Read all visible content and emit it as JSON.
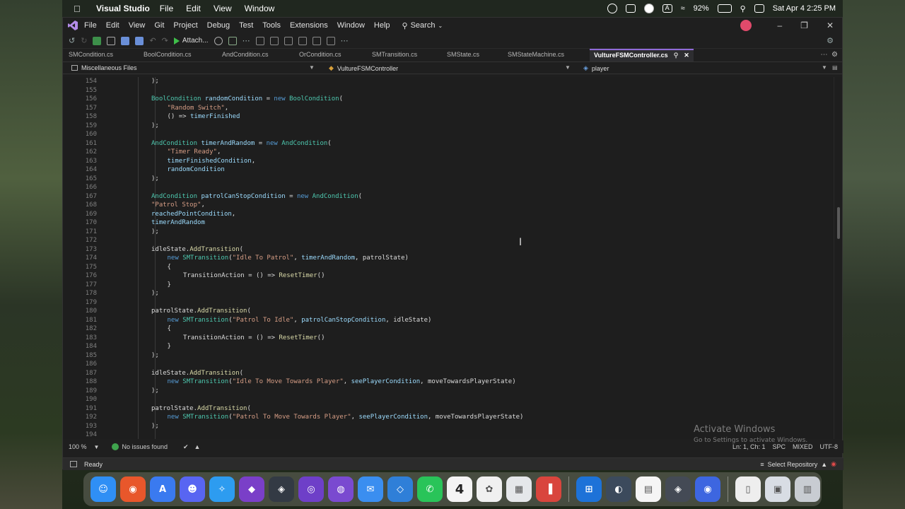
{
  "mac_menubar": {
    "app_name": "Visual Studio",
    "menus": [
      "File",
      "Edit",
      "View",
      "Window"
    ],
    "battery": "92%",
    "datetime": "Sat Apr 4  2:25 PM",
    "status_icons": [
      "shield-icon",
      "screen-mirror-icon",
      "record-icon",
      "input-source-icon",
      "wifi-icon",
      "battery-icon",
      "spotlight-icon",
      "control-center-icon"
    ]
  },
  "vs_menu": {
    "items": [
      "File",
      "Edit",
      "View",
      "Git",
      "Project",
      "Debug",
      "Test",
      "Tools",
      "Extensions",
      "Window",
      "Help"
    ],
    "search_label": "Search"
  },
  "toolbar": {
    "attach_label": "Attach..."
  },
  "tabs": [
    {
      "label": "SMCondition.cs",
      "active": false
    },
    {
      "label": "BoolCondition.cs",
      "active": false
    },
    {
      "label": "AndCondition.cs",
      "active": false
    },
    {
      "label": "OrCondition.cs",
      "active": false
    },
    {
      "label": "SMTransition.cs",
      "active": false
    },
    {
      "label": "SMState.cs",
      "active": false
    },
    {
      "label": "SMStateMachine.cs",
      "active": false
    },
    {
      "label": "VultureFSMController.cs",
      "active": true
    }
  ],
  "navbar": {
    "project": "Miscellaneous Files",
    "class": "VultureFSMController",
    "member": "player"
  },
  "code_lines": [
    {
      "n": "154",
      "indent": 0,
      "tokens": [
        [
          "pl",
          ");"
        ]
      ]
    },
    {
      "n": "155",
      "indent": 0,
      "tokens": []
    },
    {
      "n": "156",
      "indent": 0,
      "tokens": [
        [
          "ty",
          "BoolCondition"
        ],
        [
          "pl",
          " "
        ],
        [
          "id",
          "randomCondition"
        ],
        [
          "pl",
          " = "
        ],
        [
          "kw",
          "new"
        ],
        [
          "pl",
          " "
        ],
        [
          "ty",
          "BoolCondition"
        ],
        [
          "pl",
          "("
        ]
      ]
    },
    {
      "n": "157",
      "indent": 1,
      "tokens": [
        [
          "str",
          "\"Random Switch\""
        ],
        [
          "pl",
          ","
        ]
      ]
    },
    {
      "n": "158",
      "indent": 1,
      "tokens": [
        [
          "pl",
          "() => "
        ],
        [
          "id",
          "timerFinished"
        ]
      ]
    },
    {
      "n": "159",
      "indent": 0,
      "tokens": [
        [
          "pl",
          ");"
        ]
      ]
    },
    {
      "n": "160",
      "indent": 0,
      "tokens": []
    },
    {
      "n": "161",
      "indent": 0,
      "tokens": [
        [
          "ty",
          "AndCondition"
        ],
        [
          "pl",
          " "
        ],
        [
          "id",
          "timerAndRandom"
        ],
        [
          "pl",
          " = "
        ],
        [
          "kw",
          "new"
        ],
        [
          "pl",
          " "
        ],
        [
          "ty",
          "AndCondition"
        ],
        [
          "pl",
          "("
        ]
      ]
    },
    {
      "n": "162",
      "indent": 1,
      "tokens": [
        [
          "str",
          "\"Timer Ready\""
        ],
        [
          "pl",
          ","
        ]
      ]
    },
    {
      "n": "163",
      "indent": 1,
      "tokens": [
        [
          "id",
          "timerFinishedCondition"
        ],
        [
          "pl",
          ","
        ]
      ]
    },
    {
      "n": "164",
      "indent": 1,
      "tokens": [
        [
          "id",
          "randomCondition"
        ]
      ]
    },
    {
      "n": "165",
      "indent": 0,
      "tokens": [
        [
          "pl",
          ");"
        ]
      ]
    },
    {
      "n": "166",
      "indent": 0,
      "tokens": []
    },
    {
      "n": "167",
      "indent": 0,
      "tokens": [
        [
          "ty",
          "AndCondition"
        ],
        [
          "pl",
          " "
        ],
        [
          "id",
          "patrolCanStopCondition"
        ],
        [
          "pl",
          " = "
        ],
        [
          "kw",
          "new"
        ],
        [
          "pl",
          " "
        ],
        [
          "ty",
          "AndCondition"
        ],
        [
          "pl",
          "("
        ]
      ]
    },
    {
      "n": "168",
      "indent": 0,
      "tokens": [
        [
          "str",
          "\"Patrol Stop\""
        ],
        [
          "pl",
          ","
        ]
      ]
    },
    {
      "n": "169",
      "indent": 0,
      "tokens": [
        [
          "id",
          "reachedPointCondition"
        ],
        [
          "pl",
          ","
        ]
      ]
    },
    {
      "n": "170",
      "indent": 0,
      "tokens": [
        [
          "id",
          "timerAndRandom"
        ]
      ]
    },
    {
      "n": "171",
      "indent": 0,
      "tokens": [
        [
          "pl",
          ");"
        ]
      ]
    },
    {
      "n": "172",
      "indent": 0,
      "tokens": []
    },
    {
      "n": "173",
      "indent": 0,
      "tokens": [
        [
          "pl",
          "idleState."
        ],
        [
          "mt",
          "AddTransition"
        ],
        [
          "pl",
          "("
        ]
      ]
    },
    {
      "n": "174",
      "indent": 1,
      "tokens": [
        [
          "kw",
          "new"
        ],
        [
          "pl",
          " "
        ],
        [
          "ty",
          "SMTransition"
        ],
        [
          "pl",
          "("
        ],
        [
          "str",
          "\"Idle To Patrol\""
        ],
        [
          "pl",
          ", "
        ],
        [
          "id",
          "timerAndRandom"
        ],
        [
          "pl",
          ", patrolState)"
        ]
      ]
    },
    {
      "n": "175",
      "indent": 1,
      "tokens": [
        [
          "pl",
          "{"
        ]
      ]
    },
    {
      "n": "176",
      "indent": 2,
      "tokens": [
        [
          "pl",
          "TransitionAction = () => "
        ],
        [
          "mt",
          "ResetTimer"
        ],
        [
          "pl",
          "()"
        ]
      ]
    },
    {
      "n": "177",
      "indent": 1,
      "tokens": [
        [
          "pl",
          "}"
        ]
      ]
    },
    {
      "n": "178",
      "indent": 0,
      "tokens": [
        [
          "pl",
          ");"
        ]
      ]
    },
    {
      "n": "179",
      "indent": 0,
      "tokens": []
    },
    {
      "n": "180",
      "indent": 0,
      "tokens": [
        [
          "pl",
          "patrolState."
        ],
        [
          "mt",
          "AddTransition"
        ],
        [
          "pl",
          "("
        ]
      ]
    },
    {
      "n": "181",
      "indent": 1,
      "tokens": [
        [
          "kw",
          "new"
        ],
        [
          "pl",
          " "
        ],
        [
          "ty",
          "SMTransition"
        ],
        [
          "pl",
          "("
        ],
        [
          "str",
          "\"Patrol To Idle\""
        ],
        [
          "pl",
          ", "
        ],
        [
          "id",
          "patrolCanStopCondition"
        ],
        [
          "pl",
          ", idleState)"
        ]
      ]
    },
    {
      "n": "182",
      "indent": 1,
      "tokens": [
        [
          "pl",
          "{"
        ]
      ]
    },
    {
      "n": "183",
      "indent": 2,
      "tokens": [
        [
          "pl",
          "TransitionAction = () => "
        ],
        [
          "mt",
          "ResetTimer"
        ],
        [
          "pl",
          "()"
        ]
      ]
    },
    {
      "n": "184",
      "indent": 1,
      "tokens": [
        [
          "pl",
          "}"
        ]
      ]
    },
    {
      "n": "185",
      "indent": 0,
      "tokens": [
        [
          "pl",
          ");"
        ]
      ]
    },
    {
      "n": "186",
      "indent": 0,
      "tokens": []
    },
    {
      "n": "187",
      "indent": 0,
      "tokens": [
        [
          "pl",
          "idleState."
        ],
        [
          "mt",
          "AddTransition"
        ],
        [
          "pl",
          "("
        ]
      ]
    },
    {
      "n": "188",
      "indent": 1,
      "tokens": [
        [
          "kw",
          "new"
        ],
        [
          "pl",
          " "
        ],
        [
          "ty",
          "SMTransition"
        ],
        [
          "pl",
          "("
        ],
        [
          "str",
          "\"Idle To Move Towards Player\""
        ],
        [
          "pl",
          ", "
        ],
        [
          "id",
          "seePlayerCondition"
        ],
        [
          "pl",
          ", moveTowardsPlayerState)"
        ]
      ]
    },
    {
      "n": "189",
      "indent": 0,
      "tokens": [
        [
          "pl",
          ");"
        ]
      ]
    },
    {
      "n": "190",
      "indent": 0,
      "tokens": []
    },
    {
      "n": "191",
      "indent": 0,
      "tokens": [
        [
          "pl",
          "patrolState."
        ],
        [
          "mt",
          "AddTransition"
        ],
        [
          "pl",
          "("
        ]
      ]
    },
    {
      "n": "192",
      "indent": 1,
      "tokens": [
        [
          "kw",
          "new"
        ],
        [
          "pl",
          " "
        ],
        [
          "ty",
          "SMTransition"
        ],
        [
          "pl",
          "("
        ],
        [
          "str",
          "\"Patrol To Move Towards Player\""
        ],
        [
          "pl",
          ", "
        ],
        [
          "id",
          "seePlayerCondition"
        ],
        [
          "pl",
          ", moveTowardsPlayerState)"
        ]
      ]
    },
    {
      "n": "193",
      "indent": 0,
      "tokens": [
        [
          "pl",
          ");"
        ]
      ]
    },
    {
      "n": "194",
      "indent": 0,
      "tokens": []
    }
  ],
  "status": {
    "zoom": "100 %",
    "issues": "No issues found",
    "position": "Ln: 1, Ch: 1",
    "spacing": "SPC",
    "line_endings": "MIXED",
    "encoding": "UTF-8"
  },
  "watermark": {
    "title": "Activate Windows",
    "subtitle": "Go to Settings to activate Windows."
  },
  "readybar": {
    "state": "Ready",
    "repo_label": "Select Repository"
  },
  "dock": {
    "calendar_day": "4",
    "apps": [
      {
        "name": "finder-icon",
        "color": "#2f8ff5"
      },
      {
        "name": "firefox-icon",
        "color": "#e8572b"
      },
      {
        "name": "app-store-icon",
        "color": "#3a7af0"
      },
      {
        "name": "discord-icon",
        "color": "#5865f2"
      },
      {
        "name": "safari-icon",
        "color": "#2d9cf0"
      },
      {
        "name": "visual-studio-icon",
        "color": "#7a3fc8"
      },
      {
        "name": "unity-hub-icon",
        "color": "#333a44"
      },
      {
        "name": "github-desktop-icon",
        "color": "#6e3fc8"
      },
      {
        "name": "github-icon",
        "color": "#7a4ad0"
      },
      {
        "name": "mail-icon",
        "color": "#3a8ef0"
      },
      {
        "name": "network-app-icon",
        "color": "#2f7fd8"
      },
      {
        "name": "whatsapp-icon",
        "color": "#29c459"
      },
      {
        "name": "calendar-icon",
        "color": "#f4f4f4"
      },
      {
        "name": "photos-icon",
        "color": "#f0f0f0"
      },
      {
        "name": "launchpad-icon",
        "color": "#e5e7ea"
      },
      {
        "name": "parallels-icon",
        "color": "#d9453d"
      },
      {
        "name": "windows-icon",
        "color": "#1d72d8"
      },
      {
        "name": "disk-utility-icon",
        "color": "#3c4a5c"
      },
      {
        "name": "notes-icon",
        "color": "#f5f5f5"
      },
      {
        "name": "unity-icon",
        "color": "#444a55"
      },
      {
        "name": "firefox-dev-icon",
        "color": "#3d66e0"
      },
      {
        "name": "document-icon",
        "color": "#eeeeee"
      },
      {
        "name": "preview-icon",
        "color": "#d8dde4"
      },
      {
        "name": "trash-icon",
        "color": "#c8ccd2"
      }
    ]
  }
}
